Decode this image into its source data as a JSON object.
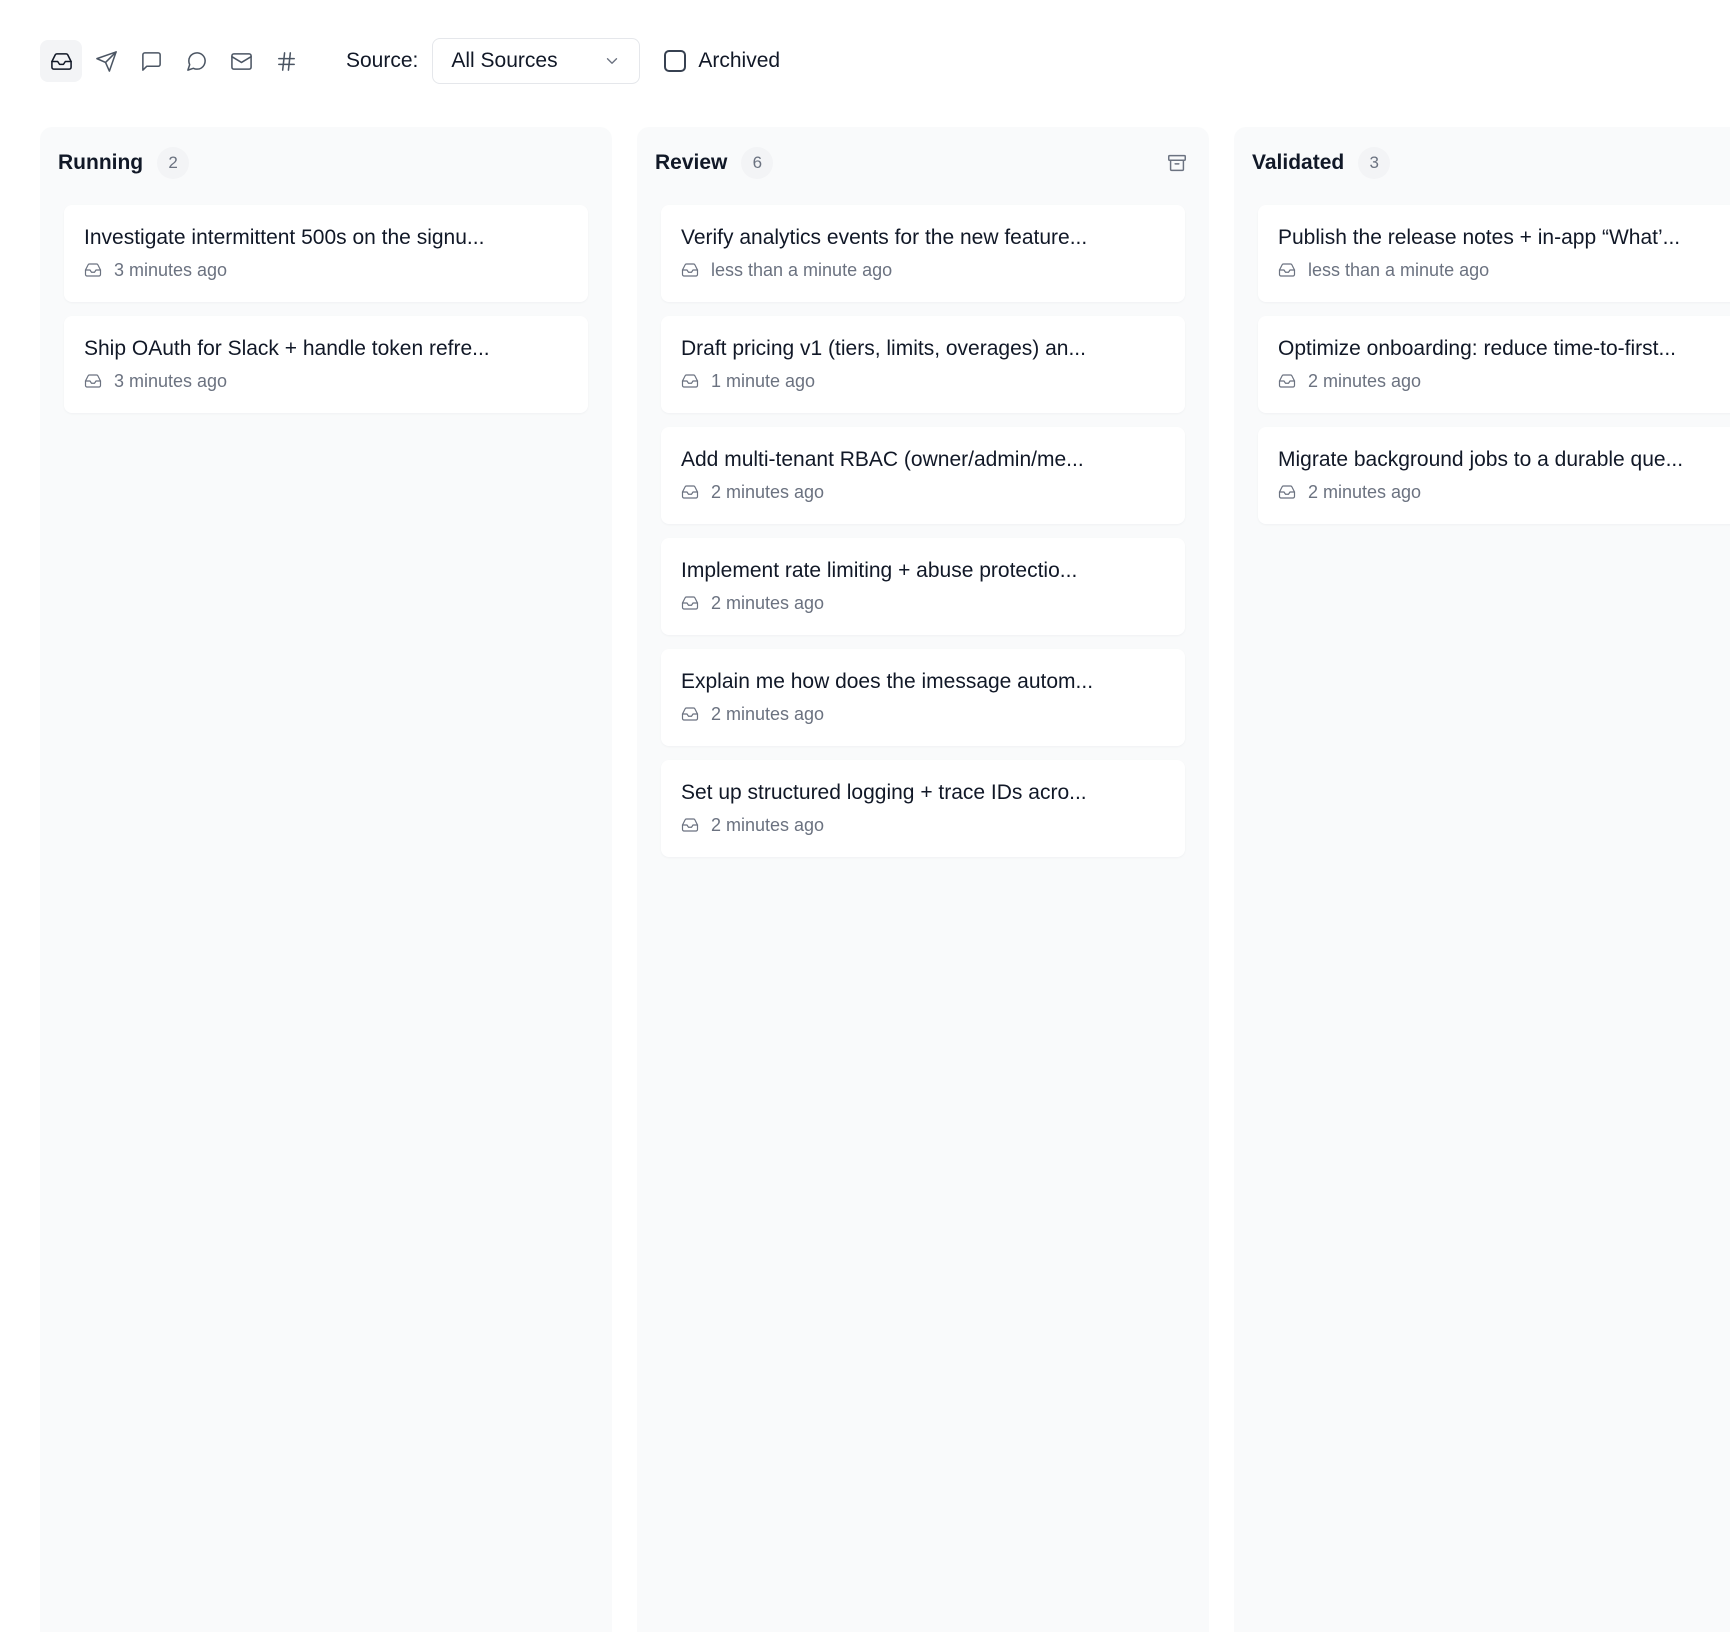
{
  "toolbar": {
    "icons": [
      "inbox-icon",
      "send-icon",
      "message-square-icon",
      "message-circle-icon",
      "mail-icon",
      "hash-icon"
    ],
    "source_label": "Source:",
    "source_value": "All Sources",
    "archived_label": "Archived"
  },
  "columns": [
    {
      "title": "Running",
      "count": "2",
      "cards": [
        {
          "title": "Investigate intermittent 500s on the signu...",
          "time": "3 minutes ago"
        },
        {
          "title": "Ship OAuth for Slack + handle token refre...",
          "time": "3 minutes ago"
        }
      ]
    },
    {
      "title": "Review",
      "count": "6",
      "cards": [
        {
          "title": "Verify analytics events for the new feature...",
          "time": "less than a minute ago"
        },
        {
          "title": "Draft pricing v1 (tiers, limits, overages) an...",
          "time": "1 minute ago"
        },
        {
          "title": "Add multi-tenant RBAC (owner/admin/me...",
          "time": "2 minutes ago"
        },
        {
          "title": "Implement rate limiting + abuse protectio...",
          "time": "2 minutes ago"
        },
        {
          "title": "Explain me how does the imessage autom...",
          "time": "2 minutes ago"
        },
        {
          "title": "Set up structured logging + trace IDs acro...",
          "time": "2 minutes ago"
        }
      ]
    },
    {
      "title": "Validated",
      "count": "3",
      "cards": [
        {
          "title": "Publish the release notes + in-app “What’...",
          "time": "less than a minute ago"
        },
        {
          "title": "Optimize onboarding: reduce time-to-first...",
          "time": "2 minutes ago"
        },
        {
          "title": "Migrate background jobs to a durable que...",
          "time": "2 minutes ago"
        }
      ]
    }
  ]
}
